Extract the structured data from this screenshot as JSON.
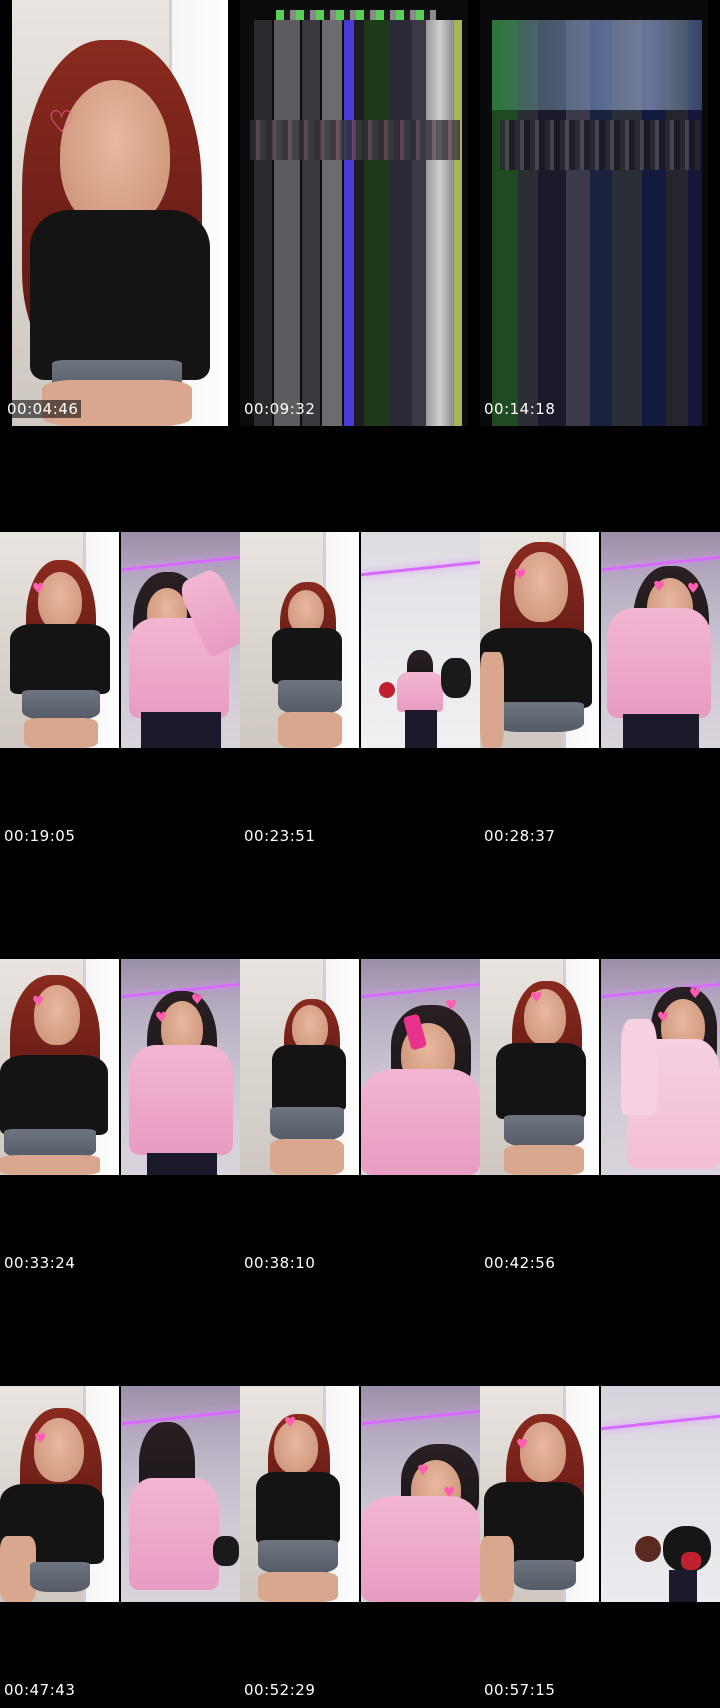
{
  "timestamps": {
    "t1": "00:04:46",
    "t2": "00:09:32",
    "t3": "00:14:18",
    "t4": "00:19:05",
    "t5": "00:23:51",
    "t6": "00:28:37",
    "t7": "00:33:24",
    "t8": "00:38:10",
    "t9": "00:42:56",
    "t10": "00:47:43",
    "t11": "00:52:29",
    "t12": "00:57:15"
  }
}
